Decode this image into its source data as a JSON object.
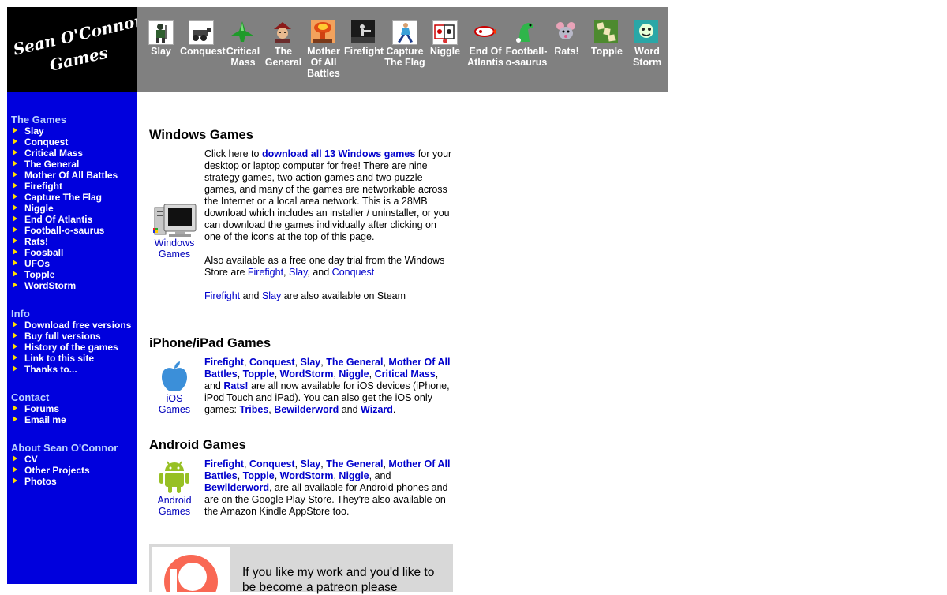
{
  "logo": {
    "line1": "Sean O'Connor's",
    "line2": "Games"
  },
  "top_games": [
    {
      "label": "Slay",
      "icon": "slay-icon"
    },
    {
      "label": "Conquest",
      "icon": "conquest-icon"
    },
    {
      "label": "Critical Mass",
      "icon": "critical-mass-icon"
    },
    {
      "label": "The General",
      "icon": "the-general-icon"
    },
    {
      "label": "Mother Of All Battles",
      "icon": "mother-of-all-battles-icon"
    },
    {
      "label": "Firefight",
      "icon": "firefight-icon"
    },
    {
      "label": "Capture The Flag",
      "icon": "capture-the-flag-icon"
    },
    {
      "label": "Niggle",
      "icon": "niggle-icon"
    },
    {
      "label": "End Of Atlantis",
      "icon": "end-of-atlantis-icon"
    },
    {
      "label": "Football-o-saurus",
      "icon": "football-o-saurus-icon"
    },
    {
      "label": "Rats!",
      "icon": "rats-icon"
    },
    {
      "label": "Topple",
      "icon": "topple-icon"
    },
    {
      "label": "Word Storm",
      "icon": "word-storm-icon"
    }
  ],
  "sidebar": {
    "games": {
      "heading": "The Games",
      "items": [
        "Slay",
        "Conquest",
        "Critical Mass",
        "The General",
        "Mother Of All Battles",
        "Firefight",
        "Capture The Flag",
        "Niggle",
        "End Of Atlantis",
        "Football-o-saurus",
        "Rats!",
        "Foosball",
        "UFOs",
        "Topple",
        "WordStorm"
      ]
    },
    "info": {
      "heading": "Info",
      "items": [
        "Download free versions",
        "Buy full versions",
        "History of the games",
        "Link to this site",
        "Thanks to..."
      ]
    },
    "contact": {
      "heading": "Contact",
      "items": [
        "Forums",
        "Email me"
      ]
    },
    "about": {
      "heading": "About Sean O'Connor",
      "items": [
        "CV",
        "Other Projects",
        "Photos"
      ]
    }
  },
  "windows": {
    "title": "Windows Games",
    "icon_label_1": "Windows",
    "icon_label_2": "Games",
    "p1_pre": "Click here to ",
    "p1_link": "download all 13 Windows games",
    "p1_post": " for your desktop or laptop computer for free! There are nine strategy games, two action games and two puzzle games, and many of the games are networkable across the Internet or a local area network. This is a 28MB download which includes an installer / uninstaller, or you can download the games individually after clicking on one of the icons at the top of this page.",
    "p2_pre": "Also available as a free one day trial from the Windows Store are ",
    "p2_l1": "Firefight",
    "p2_s1": ", ",
    "p2_l2": "Slay",
    "p2_s2": ", and ",
    "p2_l3": "Conquest",
    "p3_l1": "Firefight",
    "p3_s1": " and ",
    "p3_l2": "Slay",
    "p3_post": " are also available on Steam"
  },
  "ios": {
    "title": "iPhone/iPad Games",
    "icon_label_1": "iOS",
    "icon_label_2": "Games",
    "links1": [
      "Firefight",
      "Conquest",
      "Slay",
      "The General",
      "Mother Of All Battles",
      "Topple",
      "WordStorm",
      "Niggle",
      "Critical Mass"
    ],
    "and_word": ", and ",
    "last_link": "Rats!",
    "mid_text": " are all now available for iOS devices (iPhone, iPod Touch and iPad). You can also get the iOS only games: ",
    "only1": "Tribes",
    "only2": "Bewilderword",
    "and2": " and ",
    "only3": "Wizard",
    "end": "."
  },
  "android": {
    "title": "Android Games",
    "icon_label_1": "Android",
    "icon_label_2": "Games",
    "links1": [
      "Firefight",
      "Conquest",
      "Slay",
      "The General",
      "Mother Of All Battles",
      "Topple",
      "WordStorm",
      "Niggle"
    ],
    "and_word": ", and ",
    "last_link": "Bewilderword",
    "rest": ", are all available for Android phones and are on the Google Play Store. They're also available on the Amazon Kindle AppStore too."
  },
  "patreon": {
    "text": "If you like my work and you'd like to be become a patreon please"
  },
  "colors": {
    "sidebar_bg": "#0000dd",
    "topbar_bg": "#808080",
    "link": "#0000cc",
    "nav_heading": "#bcd3ff",
    "arrow": "#ffdd00",
    "patreon_orange": "#f96854"
  }
}
